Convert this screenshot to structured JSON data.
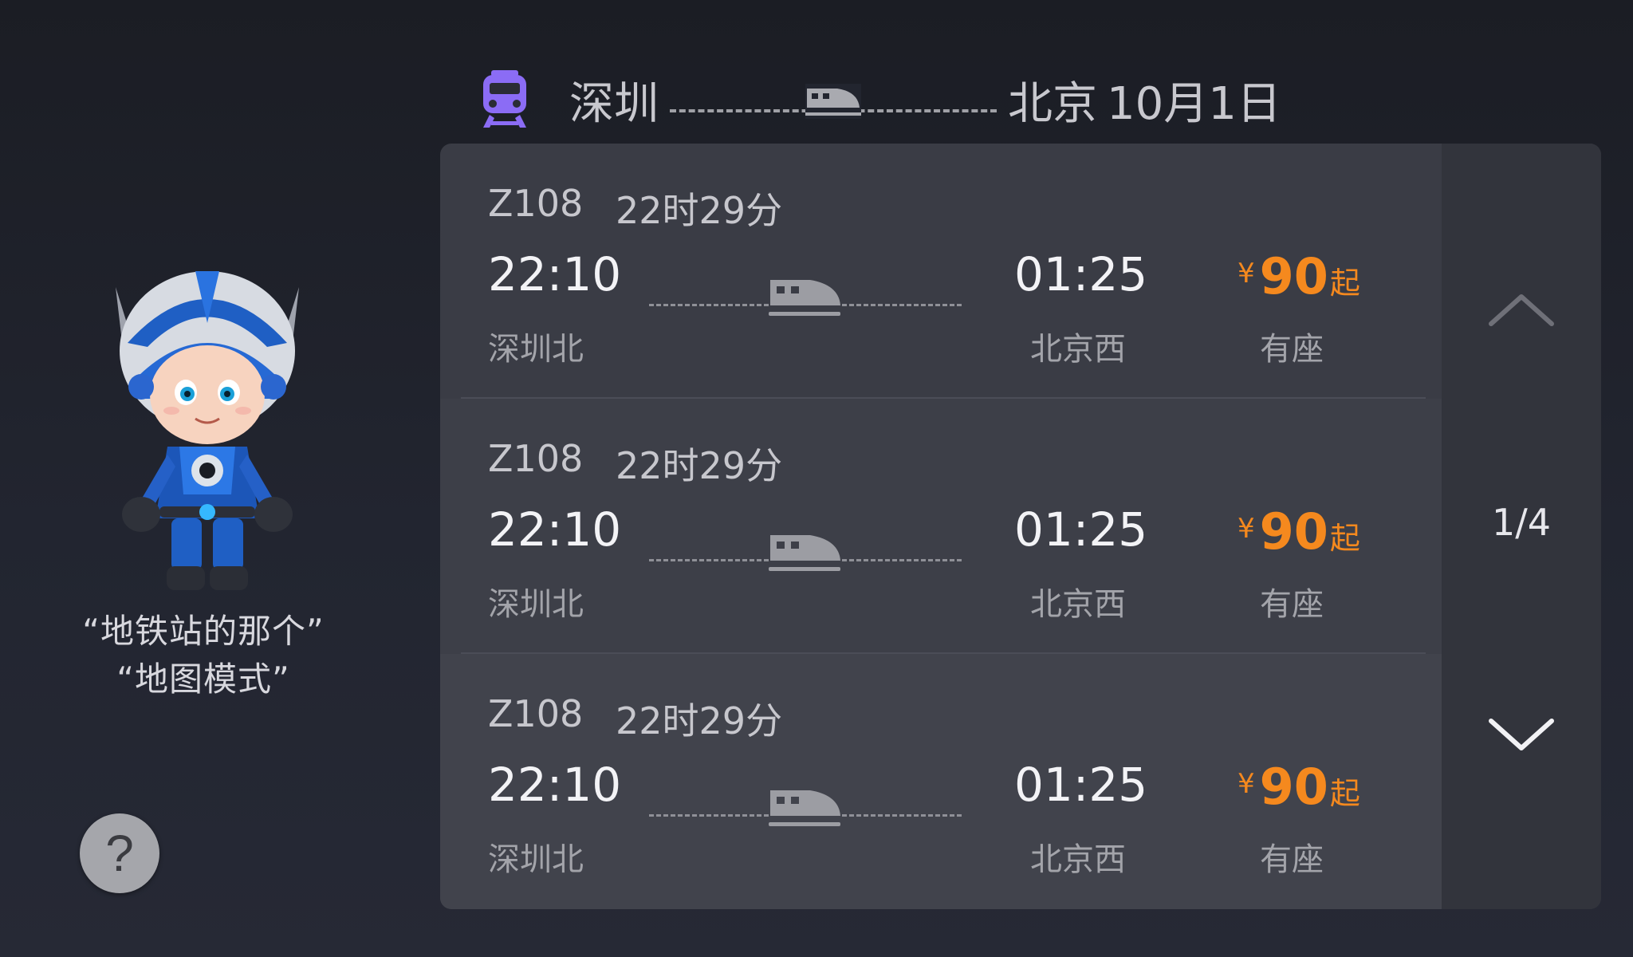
{
  "header": {
    "from_city": "深圳",
    "to_city": "北京",
    "date": "10月1日",
    "icons": {
      "train": "train-front-icon",
      "route": "high-speed-train-icon"
    },
    "accent_color": "#8b6cf5"
  },
  "assistant": {
    "avatar": "robot-mascot-avatar",
    "hints": [
      "“地铁站的那个”",
      "“地图模式”"
    ],
    "help_label": "?"
  },
  "trains": [
    {
      "train_no": "Z108",
      "duration": "22时29分",
      "depart_time": "22:10",
      "depart_station": "深圳北",
      "arrive_time": "01:25",
      "arrive_station": "北京西",
      "currency": "¥",
      "price": "90",
      "price_suffix": "起",
      "seat_status": "有座"
    },
    {
      "train_no": "Z108",
      "duration": "22时29分",
      "depart_time": "22:10",
      "depart_station": "深圳北",
      "arrive_time": "01:25",
      "arrive_station": "北京西",
      "currency": "¥",
      "price": "90",
      "price_suffix": "起",
      "seat_status": "有座"
    },
    {
      "train_no": "Z108",
      "duration": "22时29分",
      "depart_time": "22:10",
      "depart_station": "深圳北",
      "arrive_time": "01:25",
      "arrive_station": "北京西",
      "currency": "¥",
      "price": "90",
      "price_suffix": "起",
      "seat_status": "有座"
    }
  ],
  "pager": {
    "indicator": "1/4",
    "up_icon": "chevron-up-icon",
    "down_icon": "chevron-down-icon"
  },
  "colors": {
    "price": "#f5891e",
    "card_bg": "#3a3c45",
    "pager_bg": "#32343c"
  }
}
